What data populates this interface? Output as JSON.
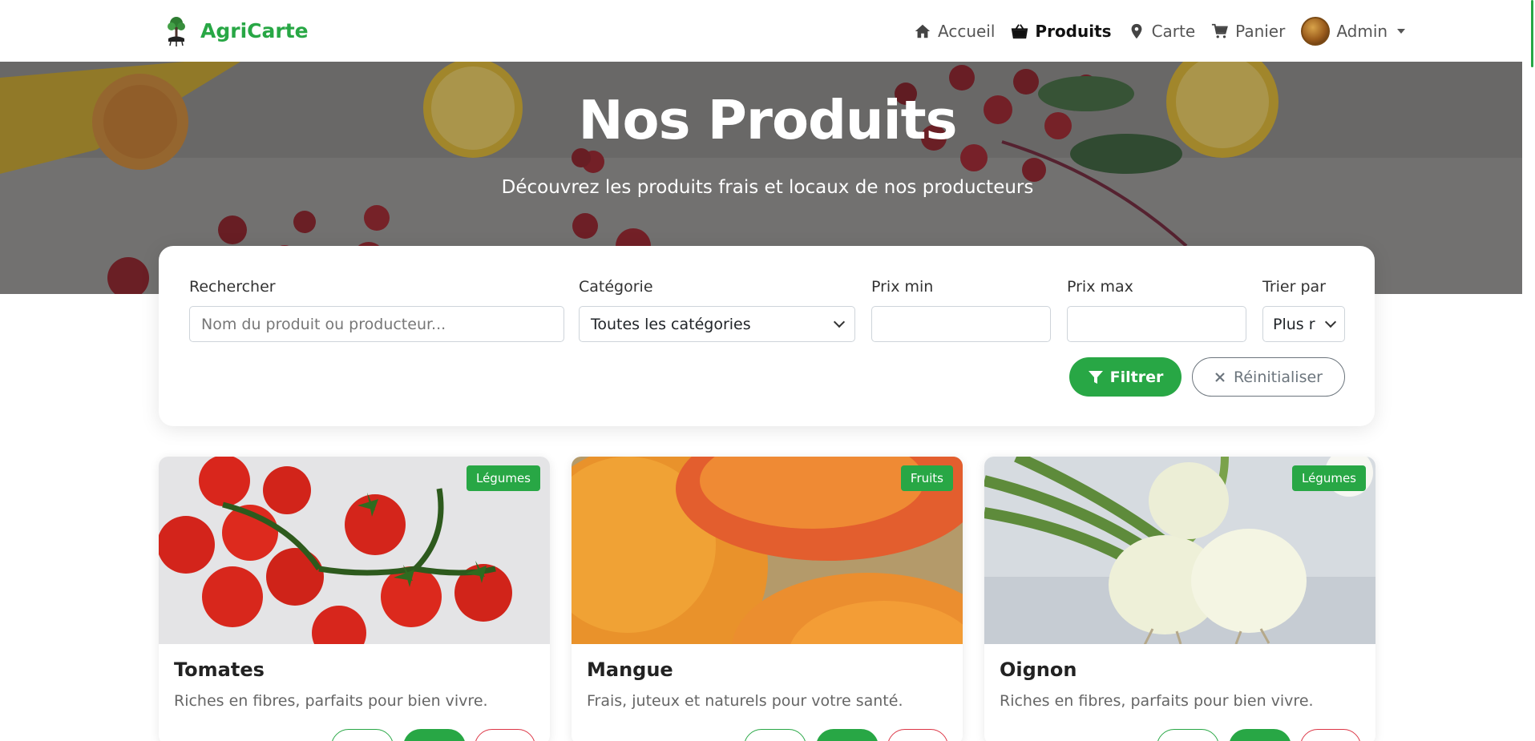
{
  "brand": {
    "name": "AgriCarte"
  },
  "nav": {
    "items": [
      {
        "label": "Accueil",
        "icon": "home-icon",
        "active": false
      },
      {
        "label": "Produits",
        "icon": "basket-icon",
        "active": true
      },
      {
        "label": "Carte",
        "icon": "map-marker-icon",
        "active": false
      },
      {
        "label": "Panier",
        "icon": "cart-icon",
        "active": false
      }
    ],
    "user": {
      "label": "Admin"
    }
  },
  "hero": {
    "title": "Nos Produits",
    "subtitle": "Découvrez les produits frais et locaux de nos producteurs"
  },
  "filters": {
    "search": {
      "label": "Rechercher",
      "placeholder": "Nom du produit ou producteur...",
      "value": ""
    },
    "category": {
      "label": "Catégorie",
      "value": "Toutes les catégories"
    },
    "price_min": {
      "label": "Prix min",
      "value": ""
    },
    "price_max": {
      "label": "Prix max",
      "value": ""
    },
    "sort": {
      "label": "Trier par",
      "value": "Plus r"
    },
    "filter_button": "Filtrer",
    "reset_button": "Réinitialiser"
  },
  "products": [
    {
      "name": "Tomates",
      "category": "Légumes",
      "description": "Riches en fibres, parfaits pour bien vivre."
    },
    {
      "name": "Mangue",
      "category": "Fruits",
      "description": "Frais, juteux et naturels pour votre santé."
    },
    {
      "name": "Oignon",
      "category": "Légumes",
      "description": "Riches en fibres, parfaits pour bien vivre."
    }
  ],
  "colors": {
    "accent": "#28a745",
    "danger": "#dc3545"
  }
}
